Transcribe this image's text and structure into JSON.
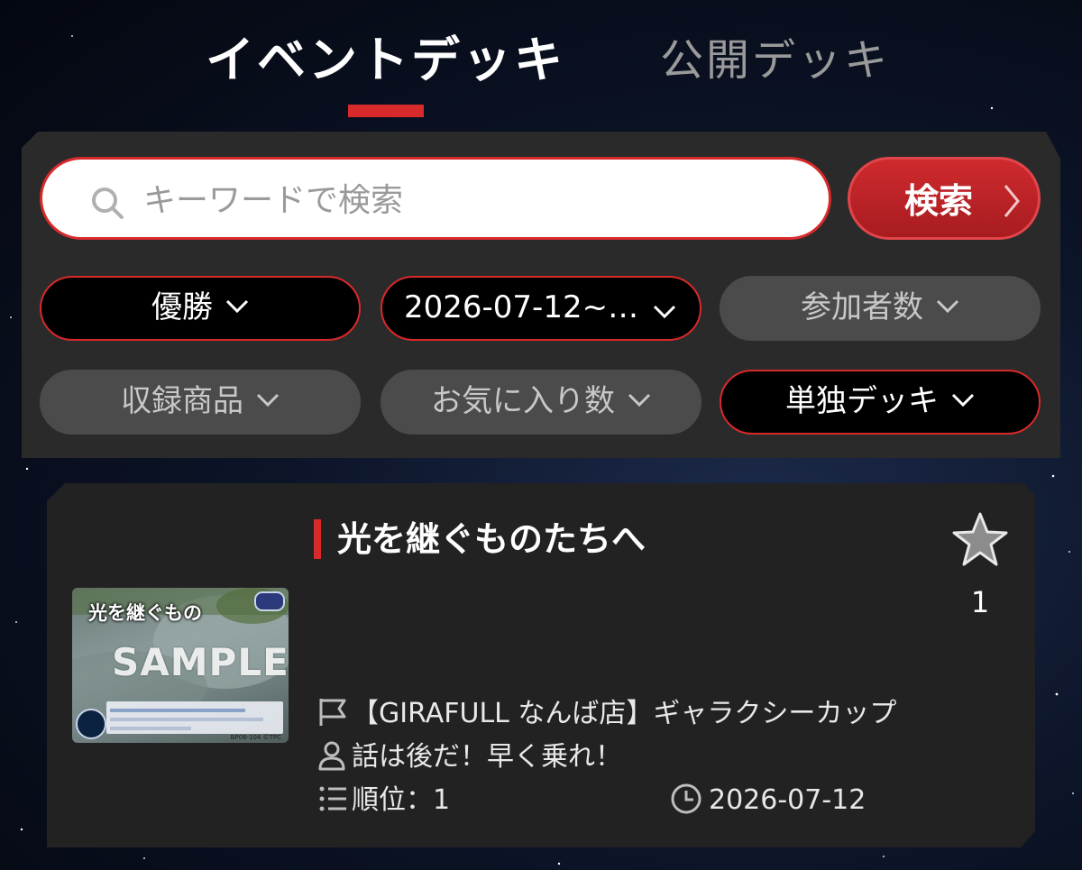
{
  "tabs": {
    "event_deck": "イベントデッキ",
    "public_deck": "公開デッキ",
    "active": "event_deck"
  },
  "search": {
    "placeholder": "キーワードで検索",
    "button_label": "検索"
  },
  "filters": [
    {
      "label": "優勝",
      "active": true
    },
    {
      "label": "2026-07-12~…",
      "active": true
    },
    {
      "label": "参加者数",
      "active": false
    },
    {
      "label": "収録商品",
      "active": false
    },
    {
      "label": "お気に入り数",
      "active": false
    },
    {
      "label": "単独デッキ",
      "active": true
    }
  ],
  "deck": {
    "title": "光を継ぐものたちへ",
    "favorite_count": "1",
    "event": "【GIRAFULL なんば店】ギャラクシーカップ",
    "player": "話は後だ！早く乗れ！",
    "rank": "順位：1",
    "date": "2026-07-12",
    "thumbnail": {
      "card_name": "光を継ぐもの",
      "watermark": "SAMPLE",
      "code": "BP08-104 ©TPC"
    }
  },
  "icons": [
    "search-icon",
    "chevron-right-icon",
    "chevron-down-icon",
    "star-icon",
    "flag-icon",
    "user-icon",
    "list-icon",
    "clock-icon"
  ],
  "colors": {
    "accent": "#d8292b",
    "panel": "#2a2a2a",
    "card": "#222222",
    "inactive_filter": "#4b4b4b"
  }
}
